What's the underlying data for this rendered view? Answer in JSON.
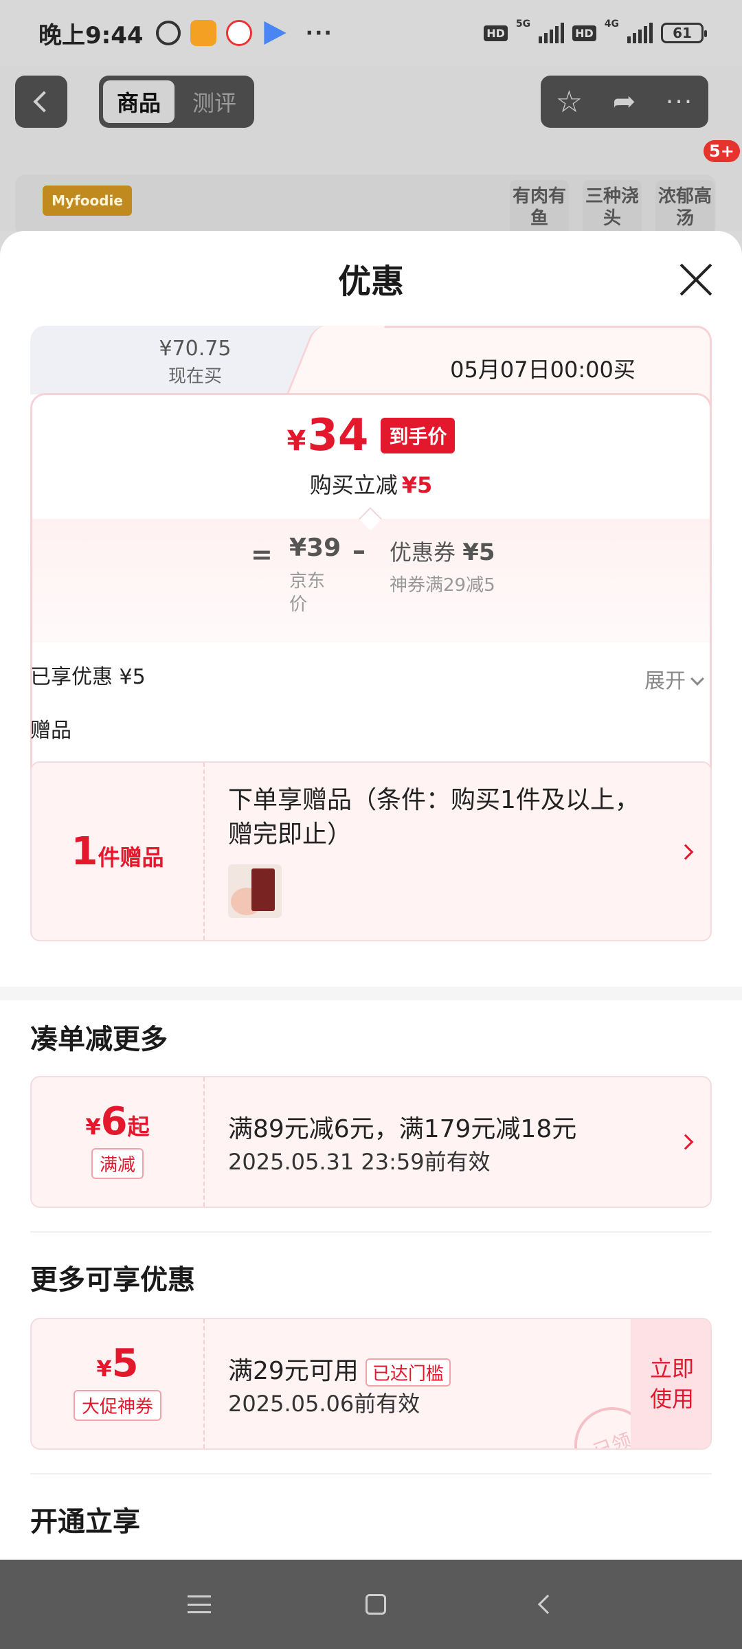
{
  "status_bar": {
    "time": "晚上9:44",
    "battery": "61",
    "hd1": "HD",
    "net1": "5G",
    "hd2": "HD",
    "net2": "4G",
    "dots": "···"
  },
  "header": {
    "tabs": [
      "商品",
      "测评"
    ],
    "badge": "5+",
    "brand": "Myfoodie",
    "features": [
      "有肉有鱼",
      "三种浇头",
      "浓郁高汤"
    ]
  },
  "sheet": {
    "title": "优惠",
    "price_tabs": {
      "now_price": "¥70.75",
      "now_label": "现在买",
      "future_label": "05月07日00:00买"
    },
    "hand_price": {
      "currency": "¥",
      "value": "34",
      "tag": "到手价"
    },
    "instant_reduce": {
      "label": "购买立减",
      "value": "¥5"
    },
    "formula": {
      "eq": "=",
      "jd_price": "¥39",
      "jd_label": "京东价",
      "minus": "–",
      "coupon_label": "优惠券",
      "coupon_value": "¥5",
      "coupon_sub": "神券满29减5"
    },
    "enjoyed": "已享优惠 ¥5",
    "expand": "展开",
    "gift_section": "赠品",
    "gift": {
      "count": "1",
      "unit": "件赠品",
      "text": "下单享赠品（条件：购买1件及以上，赠完即止）"
    },
    "combo_section": "凑单减更多",
    "combo": {
      "currency": "¥",
      "value": "6",
      "suffix": "起",
      "tag": "满减",
      "line1": "满89元减6元，满179元减18元",
      "line2": "2025.05.31 23:59前有效"
    },
    "more_section": "更多可享优惠",
    "coupon": {
      "currency": "¥",
      "value": "5",
      "tag": "大促神券",
      "line1": "满29元可用",
      "reach_tag": "已达门槛",
      "line2": "2025.05.06前有效",
      "use_button": "立即使用",
      "stamp": "已领"
    },
    "open_section": "开通立享"
  },
  "colors": {
    "accent": "#e4182c",
    "card_bg": "#fff3f4",
    "card_border": "#f6dcde"
  }
}
